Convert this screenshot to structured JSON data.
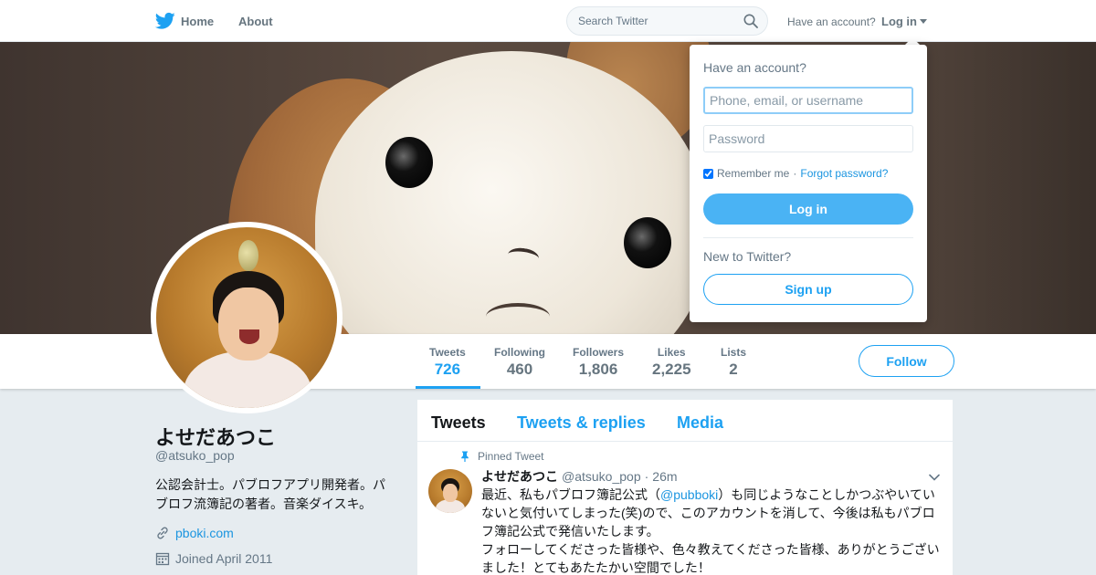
{
  "colors": {
    "brand": "#1da1f2",
    "link": "#1b95e0",
    "muted": "#657786",
    "page_bg": "#e6ecf0"
  },
  "nav": {
    "home_label": "Home",
    "home_icon": "twitter-bird-icon",
    "about_label": "About",
    "search_placeholder": "Search Twitter",
    "search_icon": "search-icon",
    "have_account": "Have an account?",
    "login_label": "Log in"
  },
  "login_dropdown": {
    "title": "Have an account?",
    "username_placeholder": "Phone, email, or username",
    "password_placeholder": "Password",
    "remember_label": "Remember me",
    "separator": "·",
    "forgot_label": "Forgot password?",
    "login_button": "Log in",
    "new_label": "New to Twitter?",
    "signup_button": "Sign up"
  },
  "stats": [
    {
      "label": "Tweets",
      "value": "726"
    },
    {
      "label": "Following",
      "value": "460"
    },
    {
      "label": "Followers",
      "value": "1,806"
    },
    {
      "label": "Likes",
      "value": "2,225"
    },
    {
      "label": "Lists",
      "value": "2"
    }
  ],
  "follow_button": "Follow",
  "profile": {
    "name": "よせだあつこ",
    "handle": "@atsuko_pop",
    "bio": "公認会計士。パブロフアプリ開発者。パブロフ流簿記の著者。音楽ダイスキ。",
    "url": "pboki.com",
    "url_icon": "link-icon",
    "joined": "Joined April 2011",
    "joined_icon": "calendar-icon"
  },
  "timeline": {
    "tabs": [
      {
        "label": "Tweets"
      },
      {
        "label": "Tweets & replies"
      },
      {
        "label": "Media"
      }
    ],
    "pinned_label": "Pinned Tweet",
    "pinned_icon": "pin-icon",
    "tweet": {
      "name": "よせだあつこ",
      "handle": "@atsuko_pop",
      "dot": "·",
      "time": "26m",
      "text_before": "最近、私もパブロフ簿記公式（",
      "mention": "@pubboki",
      "text_after": "）も同じようなことしかつぶやいていないと気付いてしまった(笑)ので、このアカウントを消して、今後は私もパブロフ簿記公式で発信いたします。",
      "text_line2": "フォローしてくださった皆様や、色々教えてくださった皆様、ありがとうございました！とてもあたたかい空間でした！"
    }
  }
}
